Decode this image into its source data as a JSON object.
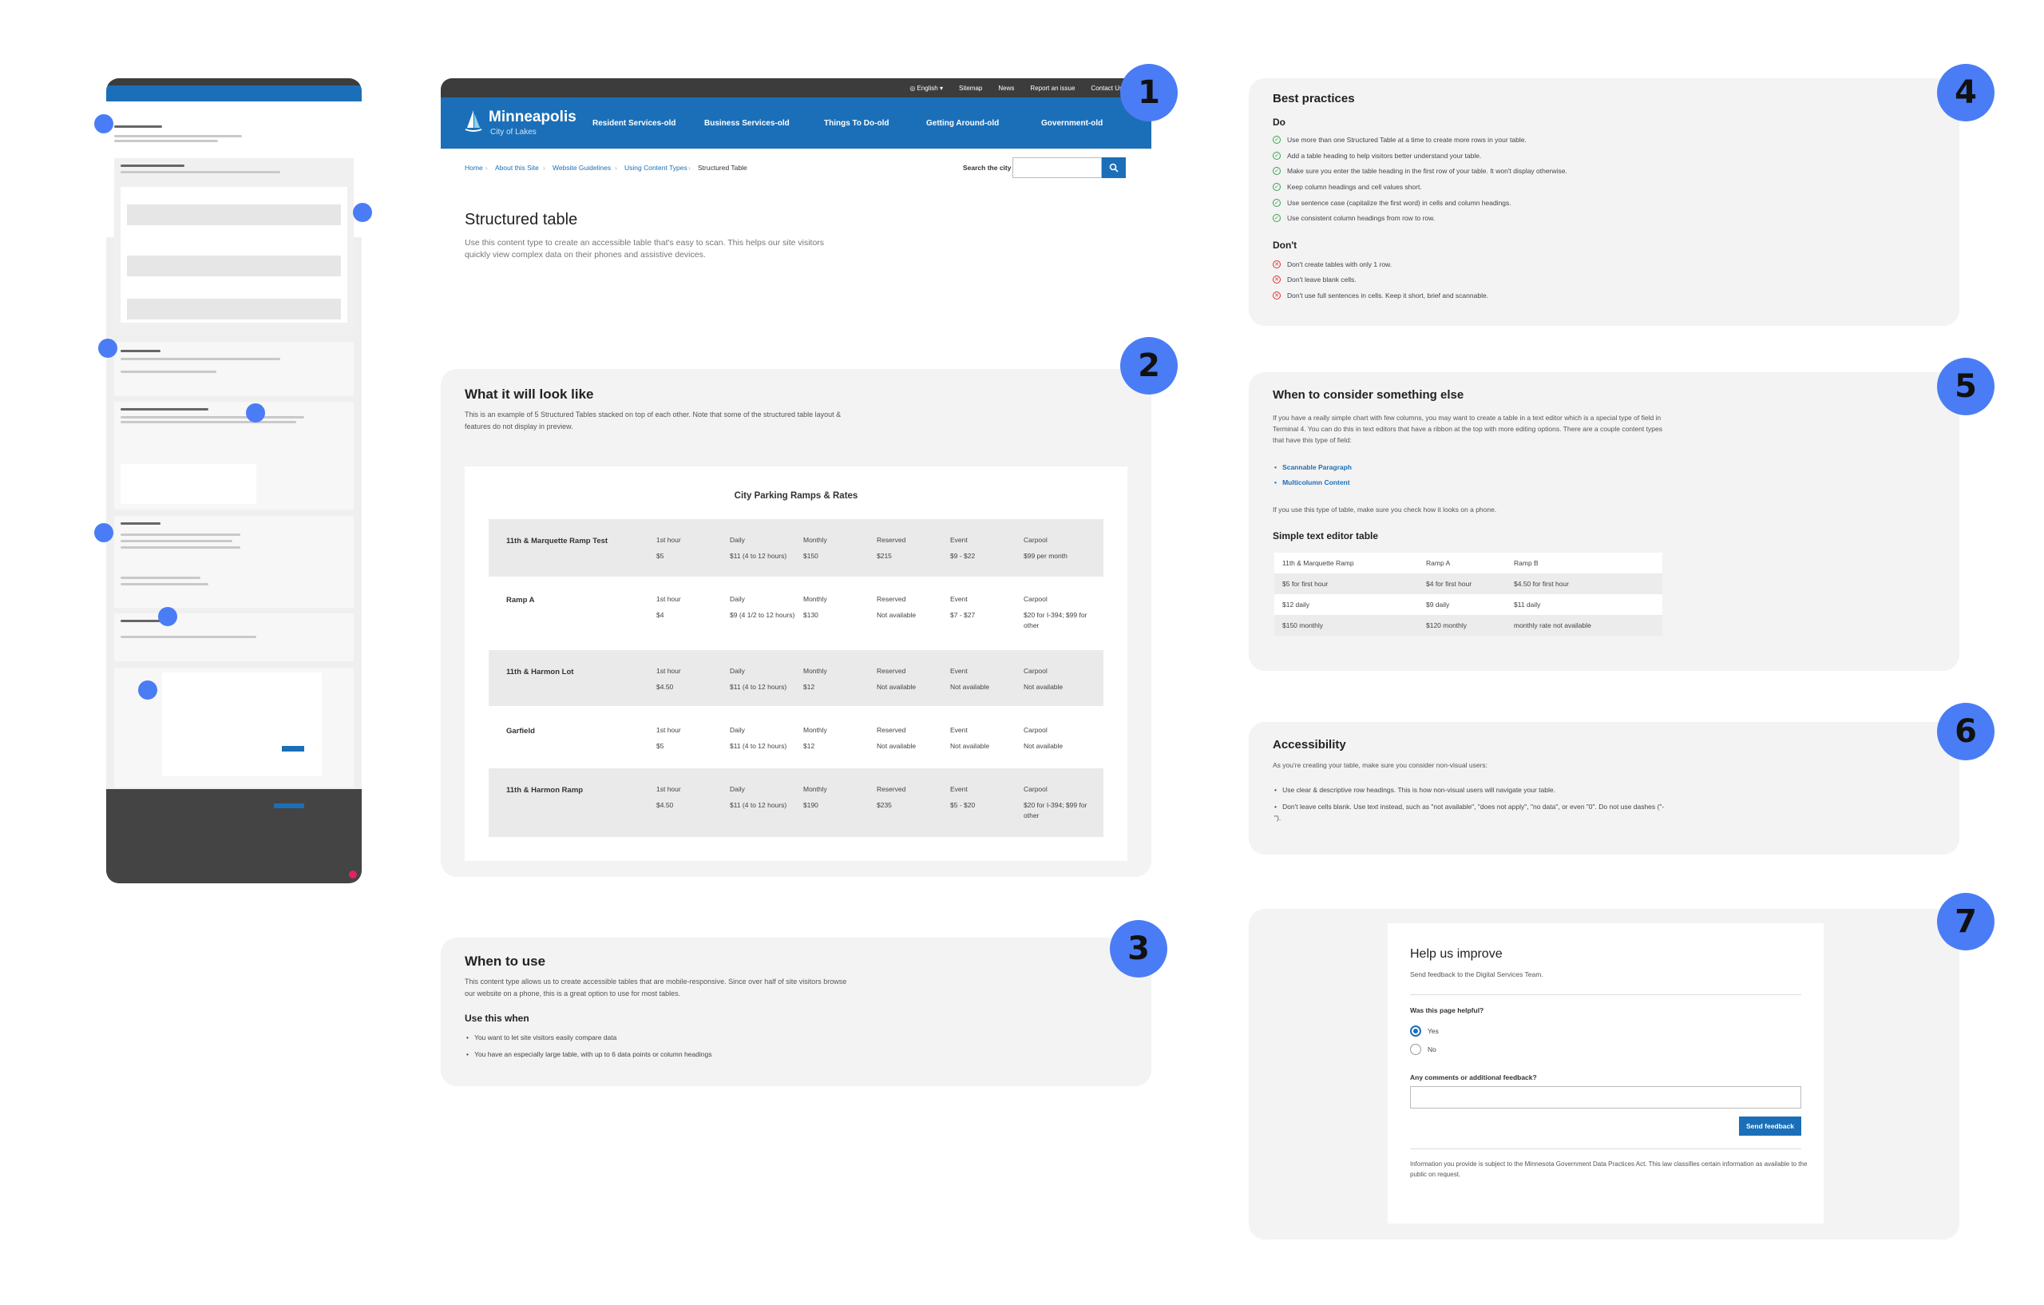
{
  "steps": [
    "1",
    "2",
    "3",
    "4",
    "5",
    "6",
    "7"
  ],
  "header": {
    "top_links": [
      "English",
      "Sitemap",
      "News",
      "Report an issue",
      "Contact Us"
    ],
    "logo_title": "Minneapolis",
    "logo_subtitle": "City of Lakes",
    "nav": [
      "Resident Services-old",
      "Business Services-old",
      "Things To Do-old",
      "Getting Around-old",
      "Government-old"
    ]
  },
  "breadcrumb": [
    "Home",
    "About this Site",
    "Website Guidelines",
    "Using Content Types",
    "Structured Table"
  ],
  "search": {
    "label": "Search the city"
  },
  "page": {
    "title": "Structured table",
    "intro": "Use this content type to create an accessible table that's easy to scan. This helps our site visitors quickly view complex data on their phones and assistive devices."
  },
  "what_it_looks_like": {
    "heading": "What it will look like",
    "text": "This is an example of 5 Structured Tables stacked on top of each other. Note that some of the structured table layout & features do not display in preview.",
    "table_title": "City Parking Ramps & Rates",
    "columns": [
      "1st hour",
      "Daily",
      "Monthly",
      "Reserved",
      "Event",
      "Carpool"
    ],
    "rows": [
      {
        "name": "11th & Marquette Ramp Test",
        "values": [
          "$5",
          "$11 (4 to 12 hours)",
          "$150",
          "$215",
          "$9 - $22",
          "$99 per month"
        ]
      },
      {
        "name": "Ramp A",
        "values": [
          "$4",
          "$9 (4 1/2 to 12 hours)",
          "$130",
          "Not available",
          "$7 - $27",
          "$20 for I-394; $99 for other"
        ]
      },
      {
        "name": "11th & Harmon Lot",
        "values": [
          "$4.50",
          "$11 (4 to 12 hours)",
          "$12",
          "Not available",
          "Not available",
          "Not available"
        ]
      },
      {
        "name": "Garfield",
        "values": [
          "$5",
          "$11 (4 to 12 hours)",
          "$12",
          "Not available",
          "Not available",
          "Not available"
        ]
      },
      {
        "name": "11th & Harmon Ramp",
        "values": [
          "$4.50",
          "$11 (4 to 12 hours)",
          "$190",
          "$235",
          "$5 - $20",
          "$20 for I-394; $99 for other"
        ]
      }
    ]
  },
  "when_to_use": {
    "heading": "When to use",
    "text": "This content type allows us to create accessible tables that are mobile-responsive. Since over half of site visitors browse our website on a phone, this is a great option to use for most tables.",
    "subheading": "Use this when",
    "items": [
      "You want to let site visitors easily compare data",
      "You have an especially large table, with up to 6 data points or column headings"
    ]
  },
  "best_practices": {
    "heading": "Best practices",
    "do_heading": "Do",
    "do": [
      "Use more than one Structured Table at a time to create more rows in your table.",
      "Add a table heading to help visitors better understand your table.",
      "Make sure you enter the table heading in the first row of your table. It won't display otherwise.",
      "Keep column headings and cell values short.",
      "Use sentence case (capitalize the first word) in cells and column headings.",
      "Use consistent column headings from row to row."
    ],
    "dont_heading": "Don't",
    "dont": [
      "Don't create tables with only 1 row.",
      "Don't leave blank cells.",
      "Don't use full sentences in cells. Keep it short, brief and scannable."
    ]
  },
  "consider_else": {
    "heading": "When to consider something else",
    "text": "If you have a really simple chart with few columns, you may want to create a table in a text editor which is a special type of field in Terminal 4. You can do this in text editors that have a ribbon at the top with more editing options. There are a couple content types that have this type of field:",
    "links": [
      "Scannable Paragraph",
      "Multicolumn Content"
    ],
    "phone_note": "If you use this type of table, make sure you check how it looks on a phone.",
    "table_heading": "Simple text editor table",
    "table_cols": [
      "11th & Marquette Ramp",
      "Ramp A",
      "Ramp B"
    ],
    "table_rows": [
      [
        "$5 for first hour",
        "$4 for first hour",
        "$4.50 for first hour"
      ],
      [
        "$12 daily",
        "$9 daily",
        "$11 daily"
      ],
      [
        "$150 monthly",
        "$120 monthly",
        "monthly rate not available"
      ]
    ]
  },
  "accessibility": {
    "heading": "Accessibility",
    "text": "As you're creating your table, make sure you consider non-visual users:",
    "items": [
      "Use clear & descriptive row headings. This is how non-visual users will navigate your table.",
      "Don't leave cells blank. Use text instead, such as \"not available\", \"does not apply\", \"no data\", or even \"0\". Do not use dashes (\"-\")."
    ]
  },
  "feedback": {
    "heading": "Help us improve",
    "sub": "Send feedback to the Digital Services Team.",
    "question": "Was this page helpful?",
    "options": [
      "Yes",
      "No"
    ],
    "selected": "Yes",
    "comments_label": "Any comments or additional feedback?",
    "button": "Send feedback",
    "disclaimer": "Information you provide is subject to the Minnesota Government Data Practices Act. This law classifies certain information as available to the public on request."
  },
  "colors": {
    "accent": "#4a7df5",
    "brand": "#1b6fb8",
    "dark": "#3c3c3c",
    "do": "#3aa34a",
    "dont": "#dd3333"
  }
}
